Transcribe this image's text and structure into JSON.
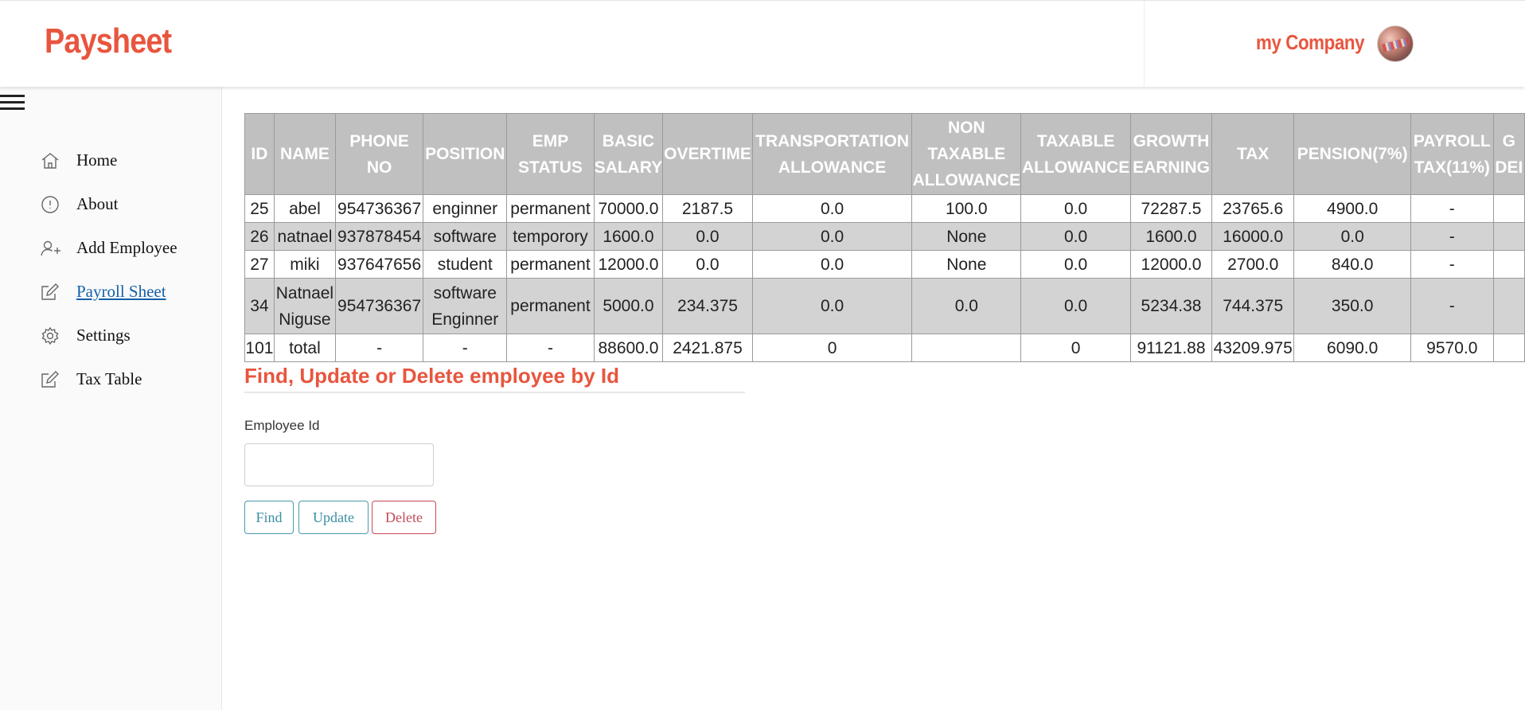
{
  "header": {
    "brand": "Paysheet",
    "company": "my Company"
  },
  "sidebar": {
    "items": [
      {
        "label": "Home",
        "icon": "home-icon"
      },
      {
        "label": "About",
        "icon": "info-icon"
      },
      {
        "label": "Add Employee",
        "icon": "add-user-icon"
      },
      {
        "label": "Payroll Sheet",
        "icon": "edit-icon",
        "active": true
      },
      {
        "label": "Settings",
        "icon": "gear-icon"
      },
      {
        "label": "Tax Table",
        "icon": "edit-icon"
      }
    ]
  },
  "table": {
    "headers": [
      "ID",
      "NAME",
      "PHONE NO",
      "POSITION",
      "EMP STATUS",
      "BASIC SALARY",
      "OVERTIME",
      "TRANSPORTATION ALLOWANCE",
      "NON TAXABLE ALLOWANCE",
      "TAXABLE ALLOWANCE",
      "GROWTH EARNING",
      "TAX",
      "PENSION(7%)",
      "PAYROLL TAX(11%)",
      "G DEI"
    ],
    "rows": [
      [
        "25",
        "abel",
        "954736367",
        "enginner",
        "permanent",
        "70000.0",
        "2187.5",
        "0.0",
        "100.0",
        "0.0",
        "72287.5",
        "23765.6",
        "4900.0",
        "-",
        ""
      ],
      [
        "26",
        "natnael",
        "937878454",
        "software",
        "temporory",
        "1600.0",
        "0.0",
        "0.0",
        "None",
        "0.0",
        "1600.0",
        "16000.0",
        "0.0",
        "-",
        ""
      ],
      [
        "27",
        "miki",
        "937647656",
        "student",
        "permanent",
        "12000.0",
        "0.0",
        "0.0",
        "None",
        "0.0",
        "12000.0",
        "2700.0",
        "840.0",
        "-",
        ""
      ],
      [
        "34",
        "Natnael Niguse",
        "954736367",
        "software Enginner",
        "permanent",
        "5000.0",
        "234.375",
        "0.0",
        "0.0",
        "0.0",
        "5234.38",
        "744.375",
        "350.0",
        "-",
        ""
      ],
      [
        "101",
        "total",
        "-",
        "-",
        "-",
        "88600.0",
        "2421.875",
        "0",
        "",
        "0",
        "91121.88",
        "43209.975",
        "6090.0",
        "9570.0",
        ""
      ]
    ]
  },
  "form": {
    "title": "Find, Update or Delete employee by Id",
    "label": "Employee Id",
    "input_value": "",
    "find_label": "Find",
    "update_label": "Update",
    "delete_label": "Delete"
  }
}
